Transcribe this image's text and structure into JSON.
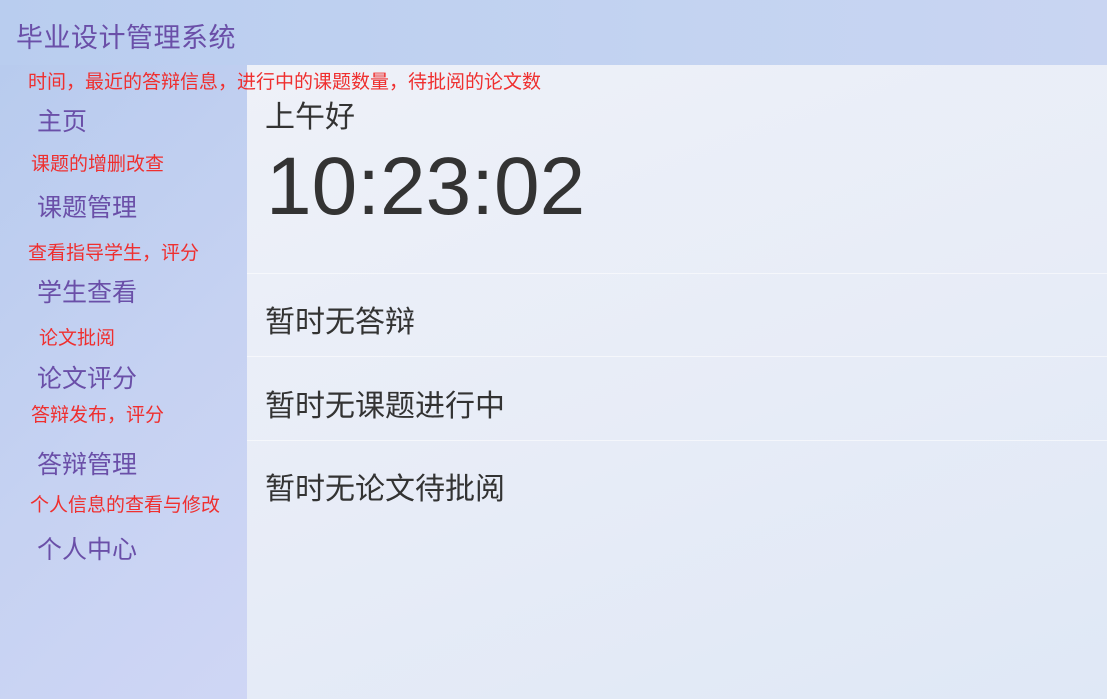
{
  "app": {
    "title": "毕业设计管理系统"
  },
  "notes": {
    "dashboard": "时间，最近的答辩信息，进行中的课题数量，待批阅的论文数",
    "topics": "课题的增删改查",
    "students": "查看指导学生，评分",
    "papers": "论文批阅",
    "defense": "答辩发布，评分",
    "profile": "个人信息的查看与修改"
  },
  "sidebar": {
    "items": [
      {
        "label": "主页"
      },
      {
        "label": "课题管理"
      },
      {
        "label": "学生查看"
      },
      {
        "label": "论文评分"
      },
      {
        "label": "答辩管理"
      },
      {
        "label": "个人中心"
      }
    ]
  },
  "main": {
    "greeting": "上午好",
    "time": "10:23:02",
    "defense_status": "暂时无答辩",
    "topic_status": "暂时无课题进行中",
    "paper_status": "暂时无论文待批阅"
  },
  "colors": {
    "nav_text": "#6a4fa8",
    "annotation": "#ef2f2f",
    "body_text": "#333333"
  }
}
